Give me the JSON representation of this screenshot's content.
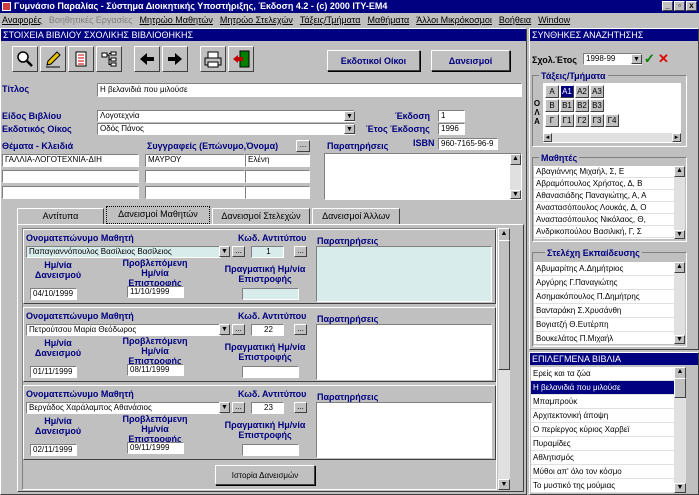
{
  "window": {
    "title": "Γυμνάσιο Παραλίας - Σύστημα Διοικητικής Υποστήριξης, Έκδοση 4.2 - (c) 2000 ITY-EM4",
    "min_label": "_",
    "max_label": "▫",
    "close_label": "x"
  },
  "menu": [
    {
      "label": "Αναφορές",
      "enabled": true
    },
    {
      "label": "Βοηθητικές Εργασίες",
      "enabled": false
    },
    {
      "label": "Μητρώο Μαθητών",
      "enabled": true
    },
    {
      "label": "Μητρώο Στελεχών",
      "enabled": true
    },
    {
      "label": "Τάξεις/Τμήματα",
      "enabled": true
    },
    {
      "label": "Μαθήματα",
      "enabled": true
    },
    {
      "label": "Άλλοι Μικρόκοσμοι",
      "enabled": true
    },
    {
      "label": "Βοήθεια",
      "enabled": true
    },
    {
      "label": "Window",
      "enabled": true
    }
  ],
  "book_panel": {
    "header": "ΣΤΟΙΧΕΙΑ ΒΙΒΛΙΟΥ ΣΧΟΛΙΚΗΣ ΒΙΒΛΙΟΘΗΚΗΣ",
    "publishers_button": "Εκδοτικοί Οίκοι",
    "loans_button": "Δανεισμοί",
    "title_label": "Τίτλος",
    "title_value": "Η βελανιδιά που μιλούσε",
    "type_label": "Είδος Βιβλίου",
    "type_value": "Λογοτεχνία",
    "edition_label": "Έκδοση",
    "edition_value": "1",
    "publisher_label": "Εκδοτικός Οίκος",
    "publisher_value": "Οδός Πάνος",
    "year_label": "Έτος Έκδοσης",
    "year_value": "1996",
    "isbn_label": "ISBN",
    "isbn_value": "960-7165-96-9",
    "topics_label": "Θέματα - Κλειδιά",
    "topics": [
      "ΓΑΛΛΙΑ-ΛΟΓΟΤΕΧΝΙΑ-ΔΙΗ",
      "",
      ""
    ],
    "authors_label": "Συγγραφείς (Επώνυμο,Όνομα)",
    "authors": [
      {
        "last": "ΜΑΥΡΟΥ",
        "first": "Ελένη"
      },
      {
        "last": "",
        "first": ""
      },
      {
        "last": "",
        "first": ""
      }
    ],
    "remarks_label": "Παρατηρήσεις",
    "ellipsis": "..."
  },
  "tabs": [
    {
      "label": "Αντίτυπα",
      "active": false
    },
    {
      "label": "Δανεισμοί Μαθητών",
      "active": true
    },
    {
      "label": "Δανεισμοί Στελεχών",
      "active": false
    },
    {
      "label": "Δανεισμοί Άλλων",
      "active": false
    }
  ],
  "loan_labels": {
    "student": "Ονοματεπώνυμο Μαθητή",
    "copy_code": "Κωδ. Αντιτύπου",
    "remarks": "Παρατηρήσεις",
    "loan_date": "Ημ/νία Δανεισμού",
    "expected_return": "Προβλεπόμενη Ημ/νία Επιστροφής",
    "actual_return": "Πραγματική Ημ/νία Επιστροφής"
  },
  "loans": [
    {
      "student": "Παπαγιαννόπουλος Βασίλειος Βασίλειος",
      "copy": "1",
      "loan_date": "04/10/1999",
      "expected": "11/10/1999",
      "actual": ""
    },
    {
      "student": "Πετρούτσου Μαρία Θεόδωρος",
      "copy": "22",
      "loan_date": "01/11/1999",
      "expected": "08/11/1999",
      "actual": ""
    },
    {
      "student": "Βεργάδος Χαράλαμπος Αθανάσιος",
      "copy": "23",
      "loan_date": "02/11/1999",
      "expected": "09/11/1999",
      "actual": ""
    }
  ],
  "history_button": "Ιστορία Δανεισμών",
  "search_panel": {
    "header": "ΣΥΝΘΗΚΕΣ ΑΝΑΖΗΤΗΣΗΣ",
    "school_year_label": "Σχολ.Έτος",
    "school_year_value": "1998-99",
    "classes_label": "Τάξεις/Τμήματα",
    "grid_row_labels": [
      "Ο",
      "Λ",
      "Α"
    ],
    "grid_rows": [
      [
        {
          "t": "Α",
          "sel": false
        },
        {
          "t": "Α1",
          "sel": true
        },
        {
          "t": "Α2",
          "sel": false
        },
        {
          "t": "Α3",
          "sel": false
        }
      ],
      [
        {
          "t": "Β",
          "sel": false
        },
        {
          "t": "Β1",
          "sel": false
        },
        {
          "t": "Β2",
          "sel": false
        },
        {
          "t": "Β3",
          "sel": false
        }
      ],
      [
        {
          "t": "Γ",
          "sel": false
        },
        {
          "t": "Γ1",
          "sel": false
        },
        {
          "t": "Γ2",
          "sel": false
        },
        {
          "t": "Γ3",
          "sel": false
        },
        {
          "t": "Γ4",
          "sel": false
        }
      ]
    ],
    "students_label": "Μαθητές",
    "students": [
      "Αβαγιάννης Μιχαήλ, Σ, Ε",
      "Αβραμόπουλος Χρήστος, Δ, Β",
      "Αθανασιάδης Παναγιώτης, Α, Α",
      "Αναστασόπουλος Λουκάς, Δ, Ο",
      "Αναστασόπουλος Νικόλαος, Θ,",
      "Ανδρικοπούλου Βασιλική, Γ, Σ"
    ],
    "staff_label": "Στελέχη Εκπαίδευσης",
    "staff": [
      "Αβυμαρίτης Α.Δημήτριος",
      "Αργύρης Γ.Παναγιώτης",
      "Ασημακόπουλος Π.Δημήτρης",
      "Βανταράκη Σ.Χρυσάνθη",
      "Βογιατζή Θ.Ευτέρπη",
      "Βουκελάτος Π.Μιχαήλ"
    ]
  },
  "selected_books": {
    "header": "ΕΠΙΛΕΓΜΕΝΑ ΒΙΒΛΙΑ",
    "items": [
      "Ερείς και τα ζώα",
      "Η βελανιδιά που μιλούσε",
      "Μπαμπρούκ",
      "Αρχιτεκτονική άποψη",
      "Ο περίεργος κύριος Χαρβεϊ",
      "Πυραμίδες",
      "Αθλητισμός",
      "Μύθοι απ' όλο τον κόσμο",
      "Το μυστικό της μούμιας"
    ],
    "selected_index": 1
  },
  "colors": {
    "accent": "#000080",
    "face": "#c0c0c0",
    "remarks_teal": "#d8ecec"
  }
}
